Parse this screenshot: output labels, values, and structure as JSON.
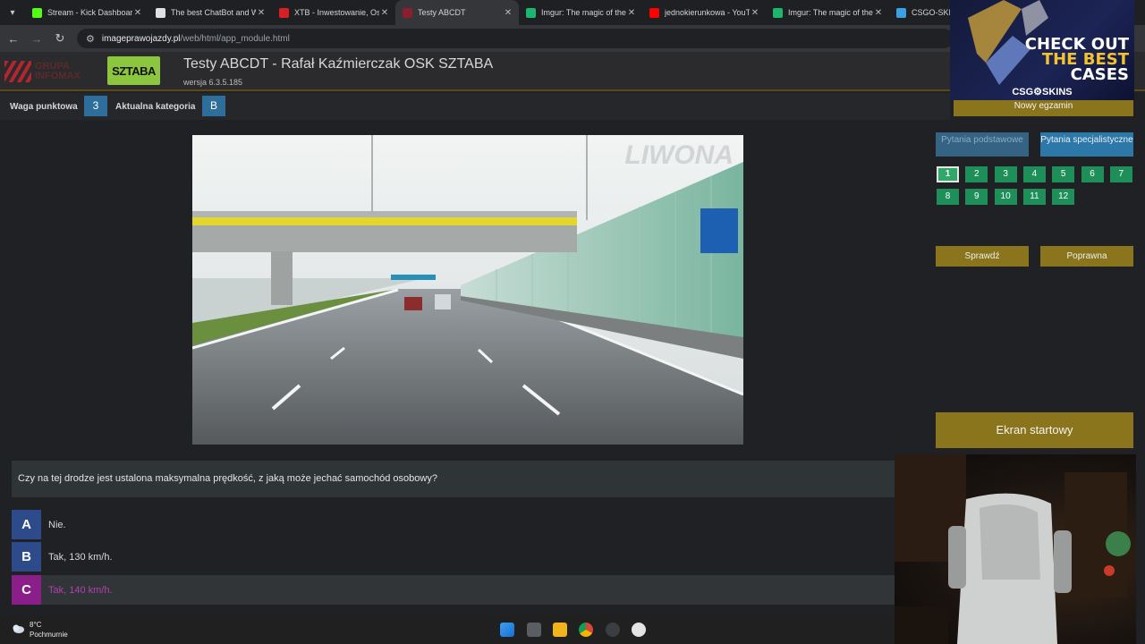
{
  "browser": {
    "tabs": [
      {
        "title": "Stream - Kick Dashboard",
        "favicon": "kick-icon",
        "color": "#53fc18"
      },
      {
        "title": "The best ChatBot and Wi",
        "favicon": "chatbot-icon",
        "color": "#e0e0e0"
      },
      {
        "title": "XTB - Inwestowanie, Oszc",
        "favicon": "xtb-icon",
        "color": "#d91f26"
      },
      {
        "title": "Testy ABCDT",
        "favicon": "testy-icon",
        "color": "#8b1e2e"
      },
      {
        "title": "Imgur: The magic of the I",
        "favicon": "imgur-icon",
        "color": "#1bb76e"
      },
      {
        "title": "jednokierunkowa - YouTu",
        "favicon": "youtube-icon",
        "color": "#ff0000"
      },
      {
        "title": "Imgur: The magic of the I",
        "favicon": "imgur-icon",
        "color": "#1bb76e"
      },
      {
        "title": "CSGO-SKINS.COM - Najle",
        "favicon": "csgo-icon",
        "color": "#3aa0e0"
      }
    ],
    "active_tab_index": 3,
    "url_domain": "imageprawojazdy.pl",
    "url_path": "/web/html/app_module.html"
  },
  "app": {
    "brand_text_1": "GRUPA",
    "brand_text_2": "INFOMAX",
    "logo_text": "SZTABA",
    "title": "Testy ABCDT - Rafał Kaźmierczak OSK SZTABA",
    "version": "wersja 6.3.5.185"
  },
  "info": {
    "weight_label": "Waga punktowa",
    "weight_value": "3",
    "category_label": "Aktualna kategoria",
    "category_value": "B"
  },
  "image": {
    "watermark": "LIWONA"
  },
  "question": {
    "text": "Czy na tej drodze jest ustalona maksymalna prędkość, z jaką może jechać samochód osobowy?",
    "answers": [
      {
        "letter": "A",
        "text": "Nie.",
        "color": "#2d4a8a",
        "selected": false
      },
      {
        "letter": "B",
        "text": "Tak, 130 km/h.",
        "color": "#2d4a8a",
        "selected": false
      },
      {
        "letter": "C",
        "text": "Tak, 140 km/h.",
        "color": "#8a1f8a",
        "selected": true
      }
    ]
  },
  "panel": {
    "new_exam": "Nowy egzamin",
    "basic_questions": "Pytania podstawowe",
    "specialist_questions": "Pytania specjalistyczne",
    "question_numbers": [
      "1",
      "2",
      "3",
      "4",
      "5",
      "6",
      "7",
      "8",
      "9",
      "10",
      "11",
      "12"
    ],
    "current_question": "1",
    "check_label": "Sprawdź",
    "correct_label": "Poprawna",
    "start_screen": "Ekran startowy"
  },
  "ad": {
    "line1": "CHECK OUT",
    "line2": "THE BEST",
    "line3": "CASES",
    "brand": "CSG⚙SKINS"
  },
  "taskbar": {
    "temperature": "8°C",
    "weather": "Pochmurnie"
  }
}
